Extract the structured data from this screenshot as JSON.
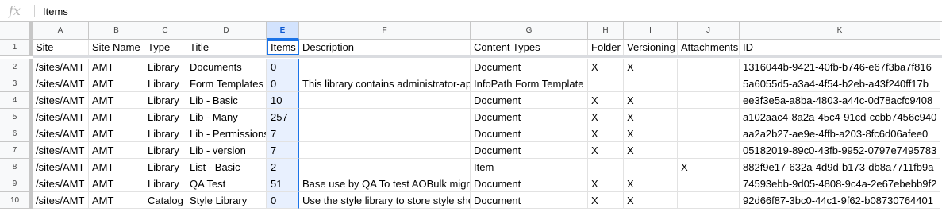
{
  "formula_bar": {
    "fx_label": "fx",
    "value": "Items"
  },
  "columns": [
    {
      "letter": "A",
      "w": 71
    },
    {
      "letter": "B",
      "w": 70
    },
    {
      "letter": "C",
      "w": 53
    },
    {
      "letter": "D",
      "w": 101
    },
    {
      "letter": "E",
      "w": 41,
      "selected": true
    },
    {
      "letter": "F",
      "w": 216
    },
    {
      "letter": "G",
      "w": 148
    },
    {
      "letter": "H",
      "w": 45
    },
    {
      "letter": "I",
      "w": 68
    },
    {
      "letter": "J",
      "w": 78
    },
    {
      "letter": "K",
      "w": 253
    }
  ],
  "rows": [
    {
      "num": "1",
      "cells": [
        "Site",
        "Site Name",
        "Type",
        "Title",
        "Items",
        "Description",
        "Content Types",
        "Folder",
        "Versioning",
        "Attachments",
        "ID"
      ]
    },
    {
      "num": "2",
      "cells": [
        "/sites/AMT",
        "AMT",
        "Library",
        "Documents",
        "0",
        "",
        "Document",
        "X",
        "X",
        "",
        "1316044b-9421-40fb-b746-e67f3ba7f816"
      ]
    },
    {
      "num": "3",
      "cells": [
        "/sites/AMT",
        "AMT",
        "Library",
        "Form Templates",
        "0",
        "This library contains administrator-ap",
        "InfoPath Form Template",
        "",
        "",
        "",
        "5a6055d5-a3a4-4f54-b2eb-a43f240ff17b"
      ]
    },
    {
      "num": "4",
      "cells": [
        "/sites/AMT",
        "AMT",
        "Library",
        "Lib - Basic",
        "10",
        "",
        "Document",
        "X",
        "X",
        "",
        "ee3f3e5a-a8ba-4803-a44c-0d78acfc9408"
      ]
    },
    {
      "num": "5",
      "cells": [
        "/sites/AMT",
        "AMT",
        "Library",
        "Lib - Many",
        "257",
        "",
        "Document",
        "X",
        "X",
        "",
        "a102aac4-8a2a-45c4-91cd-ccbb7456c940"
      ]
    },
    {
      "num": "6",
      "cells": [
        "/sites/AMT",
        "AMT",
        "Library",
        "Lib - Permissions",
        "7",
        "",
        "Document",
        "X",
        "X",
        "",
        "aa2a2b27-ae9e-4ffb-a203-8fc6d06afee0"
      ]
    },
    {
      "num": "7",
      "cells": [
        "/sites/AMT",
        "AMT",
        "Library",
        "Lib - version",
        "7",
        "",
        "Document",
        "X",
        "X",
        "",
        "05182019-89c0-43fb-9952-0797e7495783"
      ]
    },
    {
      "num": "8",
      "cells": [
        "/sites/AMT",
        "AMT",
        "Library",
        "List - Basic",
        "2",
        "",
        "Item",
        "",
        "",
        "X",
        "882f9e17-632a-4d9d-b173-db8a7711fb9a"
      ]
    },
    {
      "num": "9",
      "cells": [
        "/sites/AMT",
        "AMT",
        "Library",
        "QA Test",
        "51",
        "Base use by QA To test AOBulk migr",
        "Document",
        "X",
        "X",
        "",
        "74593ebb-9d05-4808-9c4a-2e67ebebb9f2"
      ]
    },
    {
      "num": "10",
      "cells": [
        "/sites/AMT",
        "AMT",
        "Catalog",
        "Style Library",
        "0",
        "Use the style library to store style she",
        "Document",
        "X",
        "X",
        "",
        "92d66f87-3bc0-44c1-9f62-b08730764401"
      ]
    }
  ]
}
